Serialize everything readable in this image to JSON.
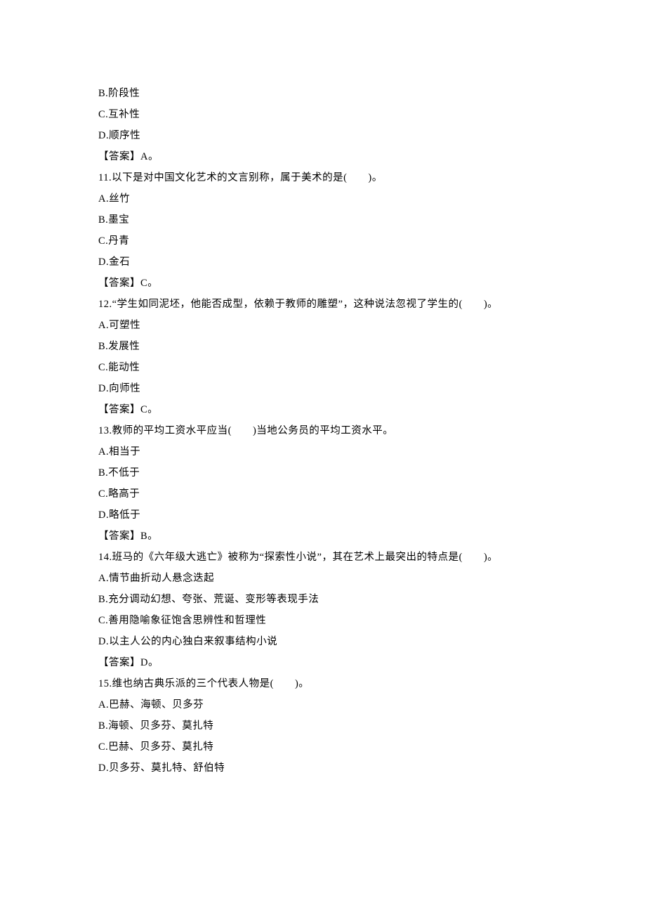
{
  "lines": [
    "B.阶段性",
    "C.互补性",
    "D.顺序性",
    "【答案】A。",
    "11.以下是对中国文化艺术的文言别称，属于美术的是(　　)。",
    "A.丝竹",
    "B.墨宝",
    "C.丹青",
    "D.金石",
    "【答案】C。",
    "12.“学生如同泥坯，他能否成型，依赖于教师的雕塑”，这种说法忽视了学生的(　　)。",
    "A.可塑性",
    "B.发展性",
    "C.能动性",
    "D.向师性",
    "【答案】C。",
    "13.教师的平均工资水平应当(　　)当地公务员的平均工资水平。",
    "A.相当于",
    "B.不低于",
    "C.略高于",
    "D.略低于",
    "【答案】B。",
    "14.班马的《六年级大逃亡》被称为“探索性小说”，其在艺术上最突出的特点是(　　)。",
    "A.情节曲折动人悬念迭起",
    "B.充分调动幻想、夸张、荒诞、变形等表现手法",
    "C.善用隐喻象征饱含思辨性和哲理性",
    "D.以主人公的内心独白来叙事结构小说",
    "【答案】D。",
    "15.维也纳古典乐派的三个代表人物是(　　)。",
    "A.巴赫、海顿、贝多芬",
    "B.海顿、贝多芬、莫扎特",
    "C.巴赫、贝多芬、莫扎特",
    "D.贝多芬、莫扎特、舒伯特"
  ]
}
